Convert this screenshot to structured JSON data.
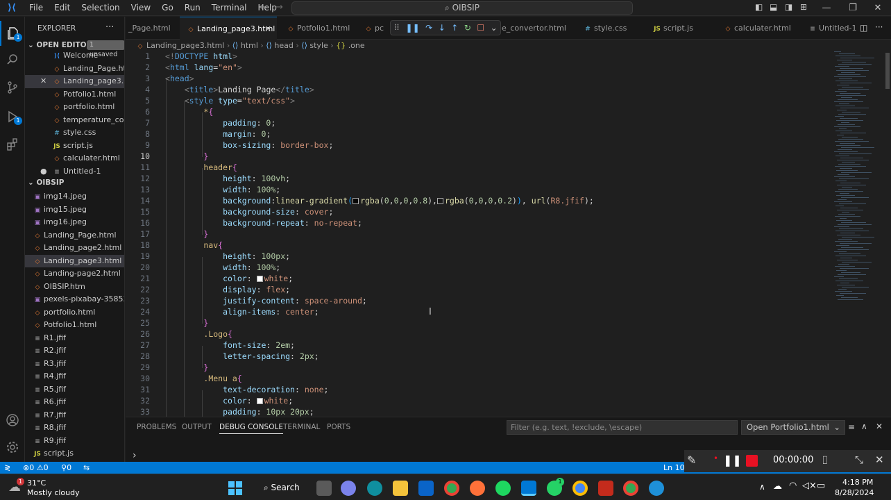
{
  "menu": [
    "File",
    "Edit",
    "Selection",
    "View",
    "Go",
    "Run",
    "Terminal",
    "Help"
  ],
  "command_center": "OIBSIP",
  "sidebar": {
    "title": "EXPLORER",
    "open_editors_label": "OPEN EDITORS",
    "unsaved_badge": "1 unsaved",
    "open_editors": [
      {
        "name": "Welcome",
        "type": "vs"
      },
      {
        "name": "Landing_Page.ht...",
        "type": "html"
      },
      {
        "name": "Landing_page3....",
        "type": "html"
      },
      {
        "name": "Potfolio1.html",
        "type": "html"
      },
      {
        "name": "portfolio.html",
        "type": "html"
      },
      {
        "name": "temperature_co...",
        "type": "html"
      },
      {
        "name": "style.css",
        "type": "css"
      },
      {
        "name": "script.js",
        "type": "js"
      },
      {
        "name": "calculater.html",
        "type": "html"
      },
      {
        "name": "Untitled-1",
        "type": "txt"
      }
    ],
    "folder_label": "OIBSIP",
    "files": [
      {
        "name": "img14.jpeg",
        "type": "img"
      },
      {
        "name": "img15.jpeg",
        "type": "img"
      },
      {
        "name": "img16.jpeg",
        "type": "img"
      },
      {
        "name": "Landing_Page.html",
        "type": "html"
      },
      {
        "name": "Landing_page2.html",
        "type": "html"
      },
      {
        "name": "Landing_page3.html",
        "type": "html"
      },
      {
        "name": "Landing-page2.html",
        "type": "html"
      },
      {
        "name": "OIBSIP.htm",
        "type": "html"
      },
      {
        "name": "pexels-pixabay-35853...",
        "type": "img"
      },
      {
        "name": "portfolio.html",
        "type": "html"
      },
      {
        "name": "Potfolio1.html",
        "type": "html"
      },
      {
        "name": "R1.jfif",
        "type": "txt"
      },
      {
        "name": "R2.jfif",
        "type": "txt"
      },
      {
        "name": "R3.jfif",
        "type": "txt"
      },
      {
        "name": "R4.jfif",
        "type": "txt"
      },
      {
        "name": "R5.jfif",
        "type": "txt"
      },
      {
        "name": "R6.jfif",
        "type": "txt"
      },
      {
        "name": "R7.jfif",
        "type": "txt"
      },
      {
        "name": "R8.jfif",
        "type": "txt"
      },
      {
        "name": "R9.jfif",
        "type": "txt"
      },
      {
        "name": "script.js",
        "type": "js"
      }
    ]
  },
  "tabs": {
    "t0": "_Page.html",
    "t1": "Landing_page3.html",
    "t2": "Potfolio1.html",
    "t3": "pc",
    "t4": "e_convertor.html",
    "t5": "style.css",
    "t6": "script.js",
    "t7": "calculater.html",
    "t8": "Untitled-1"
  },
  "breadcrumb": {
    "file": "Landing_page3.html",
    "c1": "html",
    "c2": "head",
    "c3": "style",
    "c4": ".one"
  },
  "code_start_line": 1,
  "panel": {
    "tabs": [
      "PROBLEMS",
      "OUTPUT",
      "DEBUG CONSOLE",
      "TERMINAL",
      "PORTS"
    ],
    "filter_placeholder": "Filter (e.g. text, !exclude, \\escape)",
    "console_select": "Open Portfolio1.html",
    "prompt": "›"
  },
  "status": {
    "errors": "0",
    "warnings": "0",
    "ports": "0",
    "ln": "Ln 10"
  },
  "recorder": {
    "time": "00:00:00"
  },
  "taskbar": {
    "temp": "31°C",
    "weather": "Mostly cloudy",
    "search": "Search",
    "time": "4:18 PM",
    "date": "8/28/2024",
    "weather_badge": "1",
    "whatsapp_badge": "1"
  },
  "colors": {
    "accent": "#0078d4",
    "statusbar": "#0078d4",
    "editor_bg": "#1f1f1f"
  }
}
